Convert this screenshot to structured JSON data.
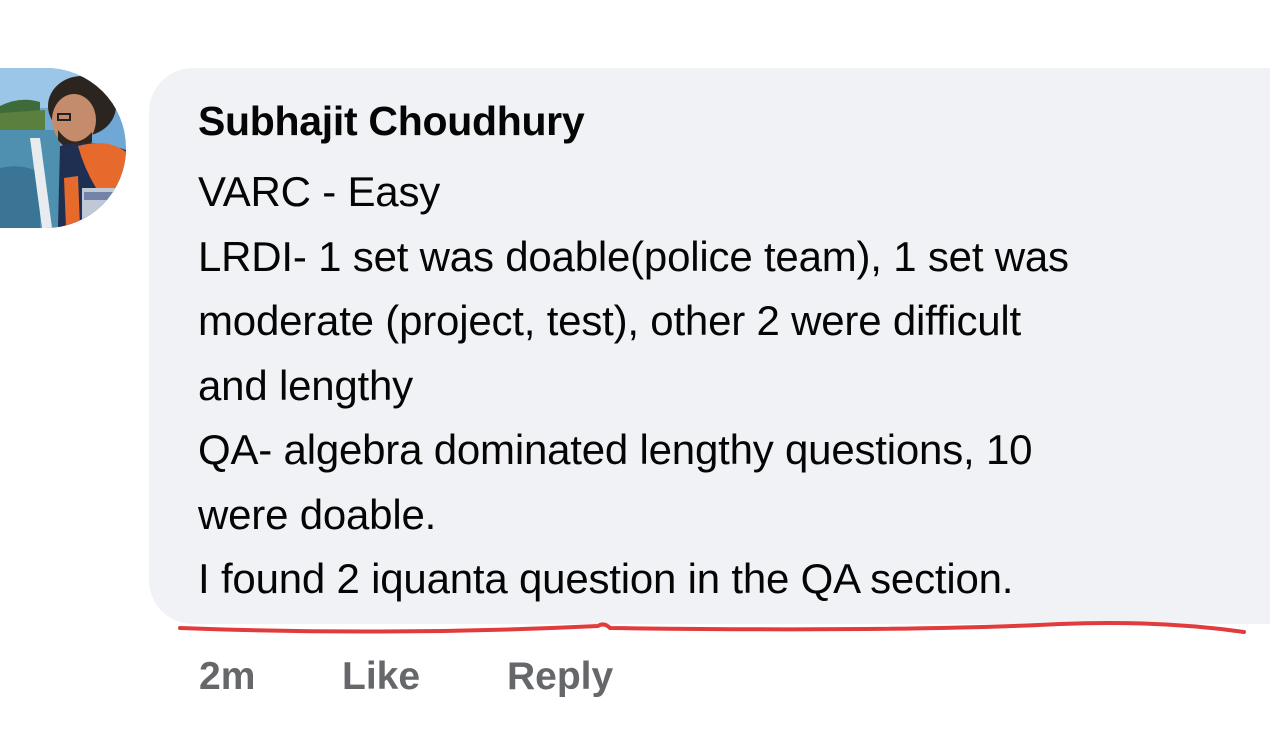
{
  "comment": {
    "author": "Subhajit Choudhury",
    "lines": [
      "VARC - Easy",
      "LRDI- 1 set was doable(police team), 1 set was",
      "moderate (project, test), other 2 were difficult",
      "and lengthy",
      "QA- algebra dominated lengthy questions, 10",
      "were doable.",
      "I found 2 iquanta question in the QA section."
    ],
    "bubble_color": "#f0f2f5",
    "text_color": "#050505"
  },
  "actions": {
    "timestamp": "2m",
    "like_label": "Like",
    "reply_label": "Reply",
    "color": "#65676b"
  },
  "annotation": {
    "type": "hand-drawn underline",
    "color": "#e23b3b"
  }
}
